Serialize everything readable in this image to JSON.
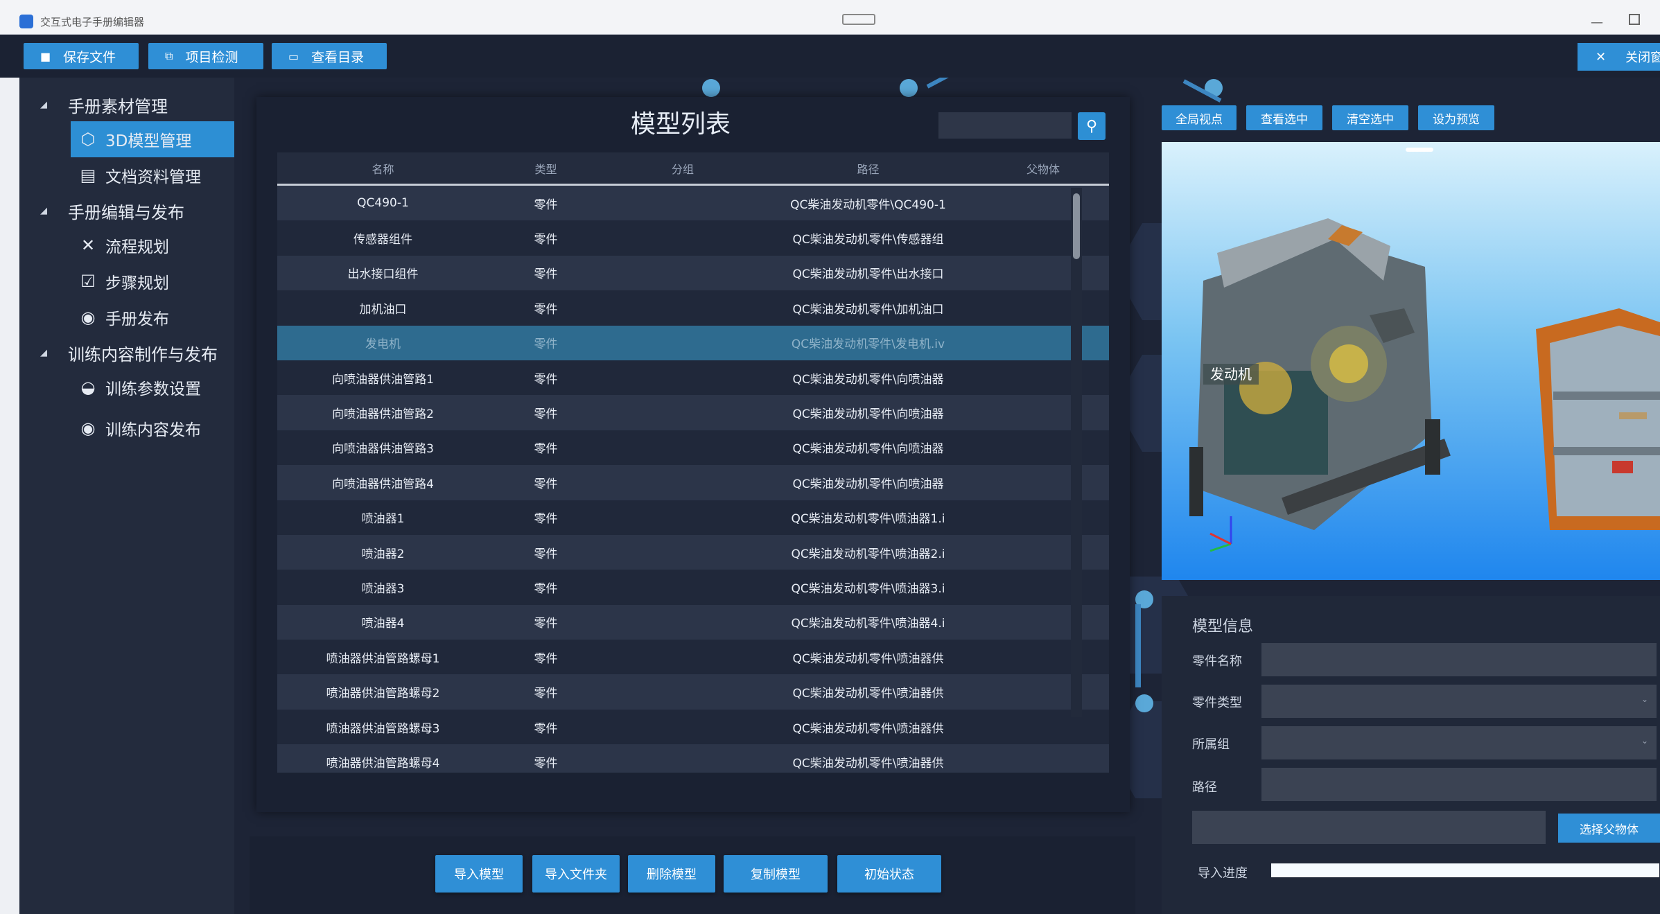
{
  "window": {
    "title": "交互式电子手册编辑器"
  },
  "toolbar": {
    "save_label": "保存文件",
    "check_label": "项目检测",
    "catalog_label": "查看目录",
    "close_label": "关闭窗"
  },
  "sidebar": {
    "groups": [
      {
        "label": "手册素材管理"
      },
      {
        "label": "手册编辑与发布"
      },
      {
        "label": "训练内容制作与发布"
      }
    ],
    "items": [
      {
        "label": "3D模型管理",
        "icon": "cube-icon"
      },
      {
        "label": "文档资料管理",
        "icon": "document-icon"
      },
      {
        "label": "流程规划",
        "icon": "tools-icon"
      },
      {
        "label": "步骤规划",
        "icon": "edit-icon"
      },
      {
        "label": "手册发布",
        "icon": "coins-icon"
      },
      {
        "label": "训练参数设置",
        "icon": "disc-icon"
      },
      {
        "label": "训练内容发布",
        "icon": "coins-icon"
      }
    ]
  },
  "model_list": {
    "title": "模型列表",
    "search_placeholder": "",
    "columns": [
      "名称",
      "类型",
      "分组",
      "路径",
      "父物体"
    ],
    "rows": [
      {
        "name": "QC490-1",
        "type": "零件",
        "group": "",
        "path": "QC柴油发动机零件\\QC490-1",
        "parent": ""
      },
      {
        "name": "传感器组件",
        "type": "零件",
        "group": "",
        "path": "QC柴油发动机零件\\传感器组",
        "parent": ""
      },
      {
        "name": "出水接口组件",
        "type": "零件",
        "group": "",
        "path": "QC柴油发动机零件\\出水接口",
        "parent": ""
      },
      {
        "name": "加机油口",
        "type": "零件",
        "group": "",
        "path": "QC柴油发动机零件\\加机油口",
        "parent": ""
      },
      {
        "name": "发电机",
        "type": "零件",
        "group": "",
        "path": "QC柴油发动机零件\\发电机.iv",
        "parent": ""
      },
      {
        "name": "向喷油器供油管路1",
        "type": "零件",
        "group": "",
        "path": "QC柴油发动机零件\\向喷油器",
        "parent": ""
      },
      {
        "name": "向喷油器供油管路2",
        "type": "零件",
        "group": "",
        "path": "QC柴油发动机零件\\向喷油器",
        "parent": ""
      },
      {
        "name": "向喷油器供油管路3",
        "type": "零件",
        "group": "",
        "path": "QC柴油发动机零件\\向喷油器",
        "parent": ""
      },
      {
        "name": "向喷油器供油管路4",
        "type": "零件",
        "group": "",
        "path": "QC柴油发动机零件\\向喷油器",
        "parent": ""
      },
      {
        "name": "喷油器1",
        "type": "零件",
        "group": "",
        "path": "QC柴油发动机零件\\喷油器1.i",
        "parent": ""
      },
      {
        "name": "喷油器2",
        "type": "零件",
        "group": "",
        "path": "QC柴油发动机零件\\喷油器2.i",
        "parent": ""
      },
      {
        "name": "喷油器3",
        "type": "零件",
        "group": "",
        "path": "QC柴油发动机零件\\喷油器3.i",
        "parent": ""
      },
      {
        "name": "喷油器4",
        "type": "零件",
        "group": "",
        "path": "QC柴油发动机零件\\喷油器4.i",
        "parent": ""
      },
      {
        "name": "喷油器供油管路螺母1",
        "type": "零件",
        "group": "",
        "path": "QC柴油发动机零件\\喷油器供",
        "parent": ""
      },
      {
        "name": "喷油器供油管路螺母2",
        "type": "零件",
        "group": "",
        "path": "QC柴油发动机零件\\喷油器供",
        "parent": ""
      },
      {
        "name": "喷油器供油管路螺母3",
        "type": "零件",
        "group": "",
        "path": "QC柴油发动机零件\\喷油器供",
        "parent": ""
      },
      {
        "name": "喷油器供油管路螺母4",
        "type": "零件",
        "group": "",
        "path": "QC柴油发动机零件\\喷油器供",
        "parent": ""
      }
    ],
    "selected_row": 4
  },
  "bottom_buttons": {
    "import_model": "导入模型",
    "import_folder": "导入文件夹",
    "delete_model": "删除模型",
    "copy_model": "复制模型",
    "initial_state": "初始状态"
  },
  "viewport": {
    "btn_global_view": "全局视点",
    "btn_view_selected": "查看选中",
    "btn_clear_selected": "清空选中",
    "btn_set_preview": "设为预览",
    "part_label": "发动机",
    "gradient_top": "#d9f1fc",
    "gradient_bottom": "#1f86ee"
  },
  "model_info": {
    "title": "模型信息",
    "part_name_label": "零件名称",
    "part_type_label": "零件类型",
    "group_label": "所属组",
    "path_label": "路径",
    "part_name_value": "",
    "part_type_value": "",
    "group_value": "",
    "path_value": "",
    "parent_value": "",
    "select_parent_label": "选择父物体",
    "progress_label": "导入进度",
    "progress_percent": 100
  },
  "colors": {
    "accent": "#2f8fd6",
    "background": "#1b2233",
    "selected_row": "#2e6b8f"
  }
}
